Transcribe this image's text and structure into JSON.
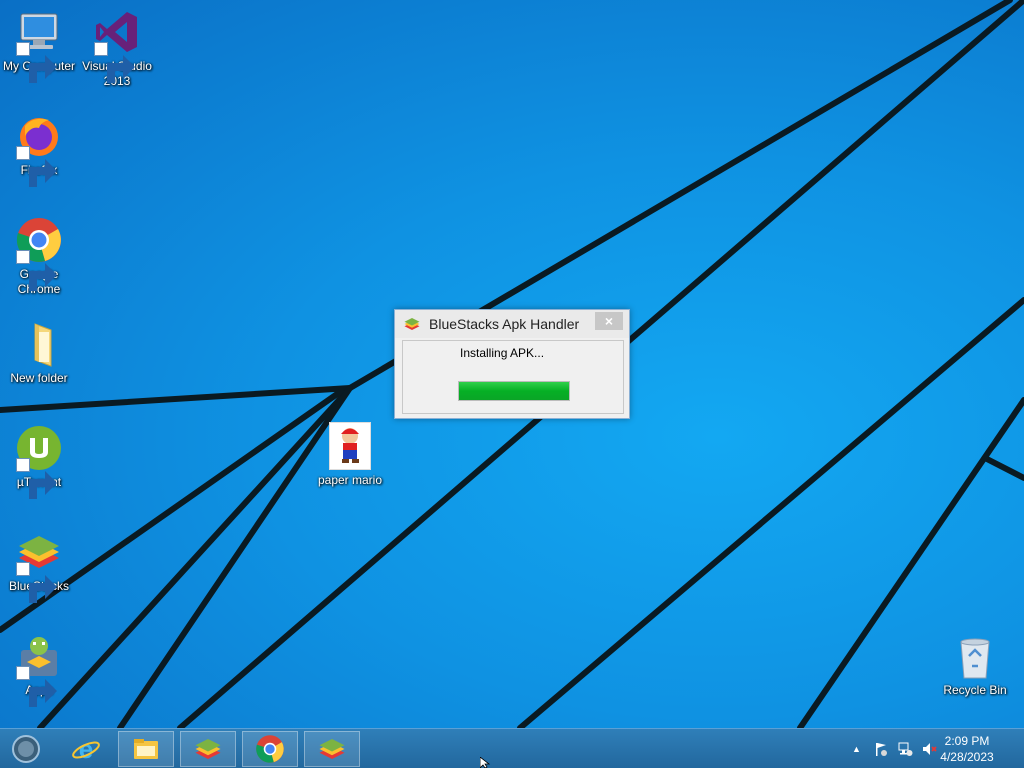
{
  "desktop": {
    "icons": [
      {
        "label": "My Computer",
        "icon": "computer-icon"
      },
      {
        "label": "Visual Studio 2013",
        "icon": "visual-studio-icon"
      },
      {
        "label": "Firefox",
        "icon": "firefox-icon"
      },
      {
        "label": "Google Chrome",
        "icon": "chrome-icon"
      },
      {
        "label": "New folder",
        "icon": "folder-icon"
      },
      {
        "label": "µTorrent",
        "icon": "utorrent-icon"
      },
      {
        "label": "BlueStacks",
        "icon": "bluestacks-icon"
      },
      {
        "label": "Apps",
        "icon": "apps-icon"
      },
      {
        "label": "paper mario",
        "icon": "paper-mario-icon"
      },
      {
        "label": "Recycle Bin",
        "icon": "recycle-bin-icon"
      }
    ]
  },
  "dialog": {
    "title": "BlueStacks Apk Handler",
    "close_label": "×",
    "status_text": "Installing APK...",
    "progress": 1.0
  },
  "taskbar": {
    "start_icon": "start-orb-icon",
    "items": [
      {
        "name": "internet-explorer",
        "icon": "ie-icon"
      },
      {
        "name": "file-explorer",
        "icon": "explorer-icon"
      },
      {
        "name": "bluestacks",
        "icon": "bluestacks-icon"
      },
      {
        "name": "chrome",
        "icon": "chrome-icon"
      },
      {
        "name": "bluestacks-apk-handler",
        "icon": "bluestacks-icon"
      }
    ],
    "tray": {
      "expand_label": "▲",
      "time": "2:09 PM",
      "date": "4/28/2023"
    }
  },
  "colors": {
    "desktop_blue": "#0f92e2",
    "taskbar": "#2a73ab",
    "progress_green": "#06b025"
  }
}
